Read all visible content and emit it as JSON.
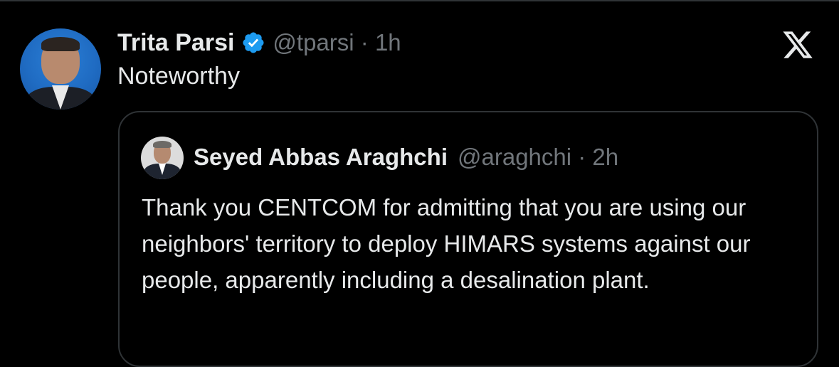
{
  "tweet": {
    "author_name": "Trita Parsi",
    "handle_time": "@tparsi · 1h",
    "text": "Noteworthy",
    "verified": true,
    "verified_color": "#1d9bf0"
  },
  "quoted_tweet": {
    "author_name": "Seyed Abbas Araghchi",
    "handle_time": "@araghchi · 2h",
    "text": "Thank you CENTCOM for admitting that you are using our neighbors' territory to deploy HIMARS systems against our people, apparently including a desalination plant."
  },
  "icons": {
    "brand": "x-logo-icon",
    "verified": "verified-badge-icon"
  },
  "colors": {
    "background": "#000000",
    "text": "#e7e9ea",
    "secondary_text": "#71767b",
    "border": "#2f3336"
  }
}
